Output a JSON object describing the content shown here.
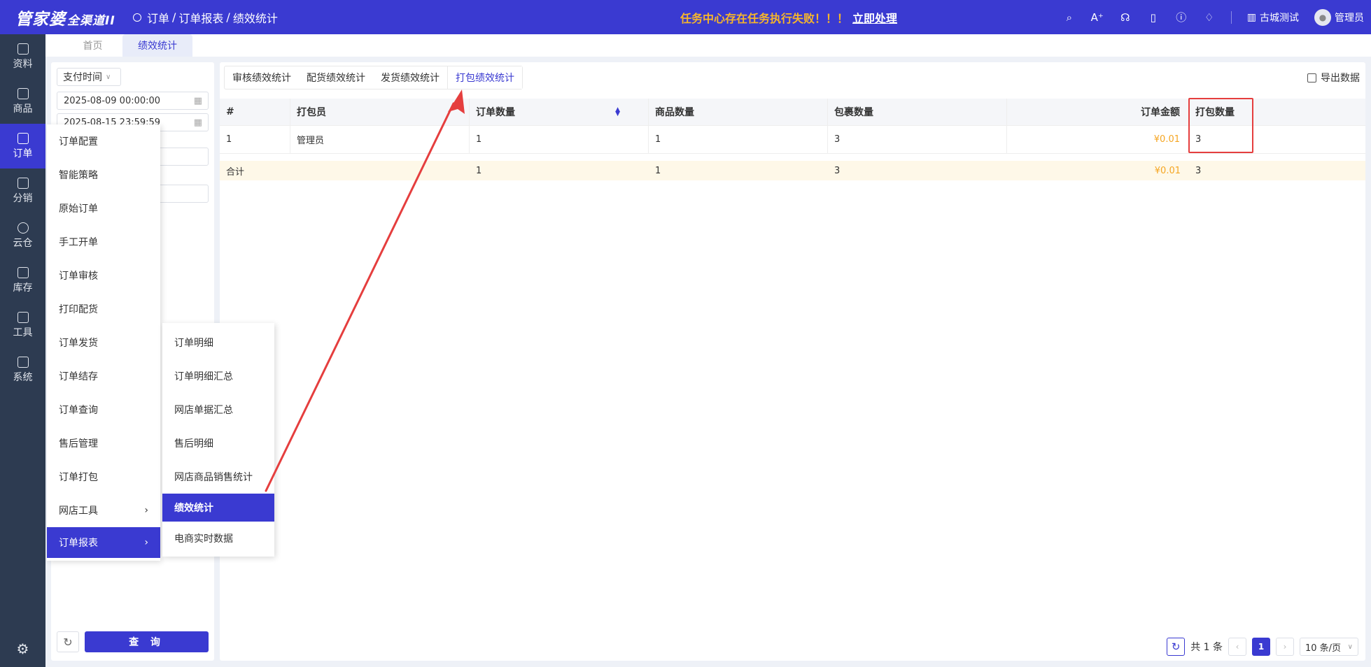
{
  "topbar": {
    "logo": "管家婆",
    "logo_sub": "全渠道II",
    "breadcrumb": [
      "订单",
      "订单报表",
      "绩效统计"
    ],
    "alert_text": "任务中心存在任务执行失败！！！",
    "alert_action": "立即处理",
    "shop": "古城测试",
    "user": "管理员",
    "icons": [
      "search-icon",
      "ai-icon",
      "headset-icon",
      "book-icon",
      "help-icon",
      "bell-icon"
    ]
  },
  "sidebar": {
    "items": [
      {
        "label": "资料"
      },
      {
        "label": "商品"
      },
      {
        "label": "订单"
      },
      {
        "label": "分销"
      },
      {
        "label": "云仓"
      },
      {
        "label": "库存"
      },
      {
        "label": "工具"
      },
      {
        "label": "系统"
      }
    ],
    "active_index": 2
  },
  "page_tabs": [
    {
      "label": "首页"
    },
    {
      "label": "绩效统计"
    }
  ],
  "filters": {
    "time_type": "支付时间",
    "start": "2025-08-09 00:00:00",
    "end": "2025-08-15 23:59:59",
    "query_label": "查 询"
  },
  "menu": {
    "items": [
      {
        "label": "订单配置"
      },
      {
        "label": "智能策略"
      },
      {
        "label": "原始订单"
      },
      {
        "label": "手工开单"
      },
      {
        "label": "订单审核"
      },
      {
        "label": "打印配货"
      },
      {
        "label": "订单发货"
      },
      {
        "label": "订单结存"
      },
      {
        "label": "订单查询"
      },
      {
        "label": "售后管理"
      },
      {
        "label": "订单打包"
      },
      {
        "label": "网店工具"
      },
      {
        "label": "订单报表"
      }
    ],
    "sub_items": [
      {
        "label": "订单明细"
      },
      {
        "label": "订单明细汇总"
      },
      {
        "label": "网店单据汇总"
      },
      {
        "label": "售后明细"
      },
      {
        "label": "网店商品销售统计"
      },
      {
        "label": "绩效统计"
      },
      {
        "label": "电商实时数据"
      }
    ]
  },
  "subtabs": [
    {
      "label": "审核绩效统计"
    },
    {
      "label": "配货绩效统计"
    },
    {
      "label": "发货绩效统计"
    },
    {
      "label": "打包绩效统计"
    }
  ],
  "export_label": "导出数据",
  "table": {
    "headers": [
      "#",
      "打包员",
      "订单数量",
      "商品数量",
      "包裹数量",
      "订单金额",
      "打包数量"
    ],
    "rows": [
      [
        "1",
        "管理员",
        "1",
        "1",
        "3",
        "¥0.01",
        "3"
      ]
    ],
    "summary": [
      "合计",
      "",
      "1",
      "1",
      "3",
      "¥0.01",
      "3"
    ]
  },
  "pager": {
    "total": "共 1 条",
    "page": "1",
    "size": "10 条/页"
  },
  "colors": {
    "brand": "#3a3ad1",
    "sidebar": "#2d3b51",
    "alert": "#f7b62a",
    "highlight": "#e53e3e",
    "money": "#f5a623"
  }
}
